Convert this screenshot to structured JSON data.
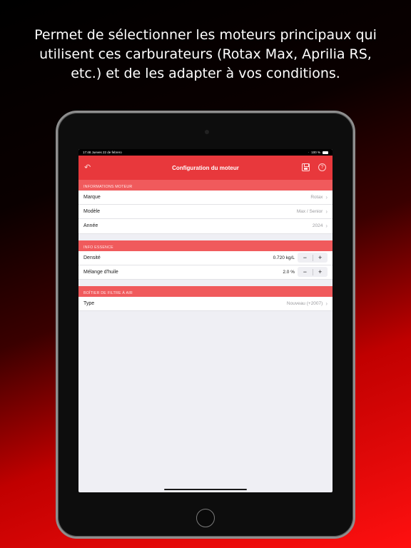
{
  "headline": "Permet de sélectionner les moteurs principaux qui utilisent ces carburateurs (Rotax Max, Aprilia RS, etc.) et de les adapter à vos conditions.",
  "status_bar": {
    "time": "17:48",
    "date": "Jueves 22 de febrero",
    "battery": "100 %"
  },
  "navbar": {
    "title": "Configuration du moteur",
    "back_icon": "back-arrow-icon",
    "save_icon": "save-icon",
    "help_icon": "help-icon",
    "help_glyph": "?"
  },
  "sections": {
    "engine": {
      "header": "INFORMATIONS MOTEUR",
      "rows": [
        {
          "label": "Marque",
          "value": "Rotax"
        },
        {
          "label": "Modèle",
          "value": "Max / Senior"
        },
        {
          "label": "Année",
          "value": "2024"
        }
      ]
    },
    "fuel": {
      "header": "INFO ESSENCE",
      "rows": [
        {
          "label": "Densité",
          "value": "0.720 kg/L",
          "minus": "−",
          "plus": "+"
        },
        {
          "label": "Mélange d'huile",
          "value": "2.0 %",
          "minus": "−",
          "plus": "+"
        }
      ]
    },
    "airbox": {
      "header": "BOÎTIER DE FILTRE À AIR",
      "rows": [
        {
          "label": "Type",
          "value": "Nouveau (+2007)"
        }
      ]
    }
  },
  "colors": {
    "accent": "#e8383c",
    "section_header": "#f05a5c"
  }
}
